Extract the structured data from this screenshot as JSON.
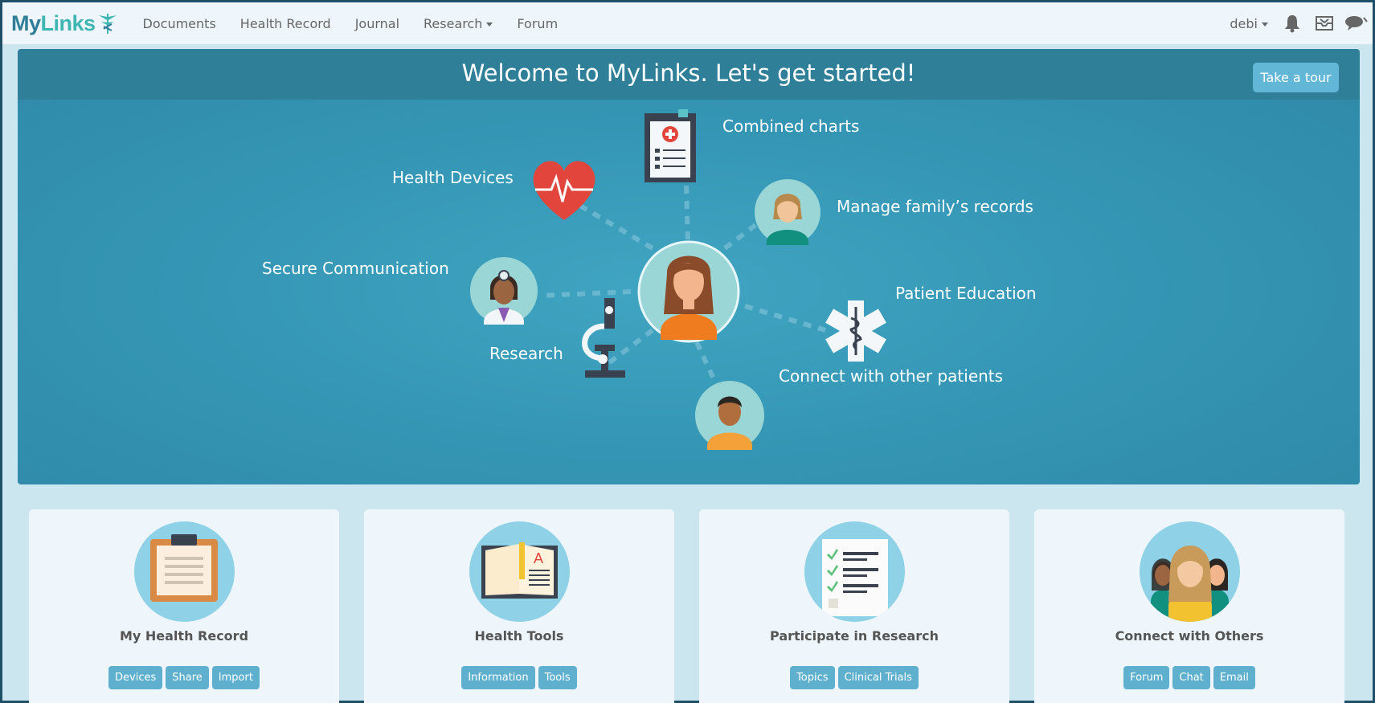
{
  "navbar": {
    "logo_my": "My",
    "logo_links": "Links",
    "items": [
      {
        "label": "Documents"
      },
      {
        "label": "Health Record"
      },
      {
        "label": "Journal"
      },
      {
        "label": "Research"
      },
      {
        "label": "Forum"
      }
    ],
    "user": "debi",
    "icons": [
      "bell-icon",
      "inbox-icon",
      "chat-icon"
    ]
  },
  "hero": {
    "title": "Welcome to MyLinks. Let's get started!",
    "tour_button": "Take a tour",
    "features": {
      "combined_charts": "Combined charts",
      "health_devices": "Health Devices",
      "manage_family": "Manage family’s records",
      "secure_communication": "Secure Communication",
      "patient_education": "Patient Education",
      "research": "Research",
      "connect_patients": "Connect with other patients"
    }
  },
  "cards": [
    {
      "title": "My Health Record",
      "icon": "clipboard-icon",
      "buttons": [
        "Devices",
        "Share",
        "Import"
      ]
    },
    {
      "title": "Health Tools",
      "icon": "book-icon",
      "buttons": [
        "Information",
        "Tools"
      ]
    },
    {
      "title": "Participate in Research",
      "icon": "checklist-icon",
      "buttons": [
        "Topics",
        "Clinical Trials"
      ]
    },
    {
      "title": "Connect with Others",
      "icon": "people-icon",
      "buttons": [
        "Forum",
        "Chat",
        "Email"
      ]
    }
  ],
  "colors": {
    "brand_dark": "#2f7d96",
    "brand_light": "#3fb6b2",
    "hero_bg": "#3597b5",
    "button": "#5fb0cf"
  }
}
